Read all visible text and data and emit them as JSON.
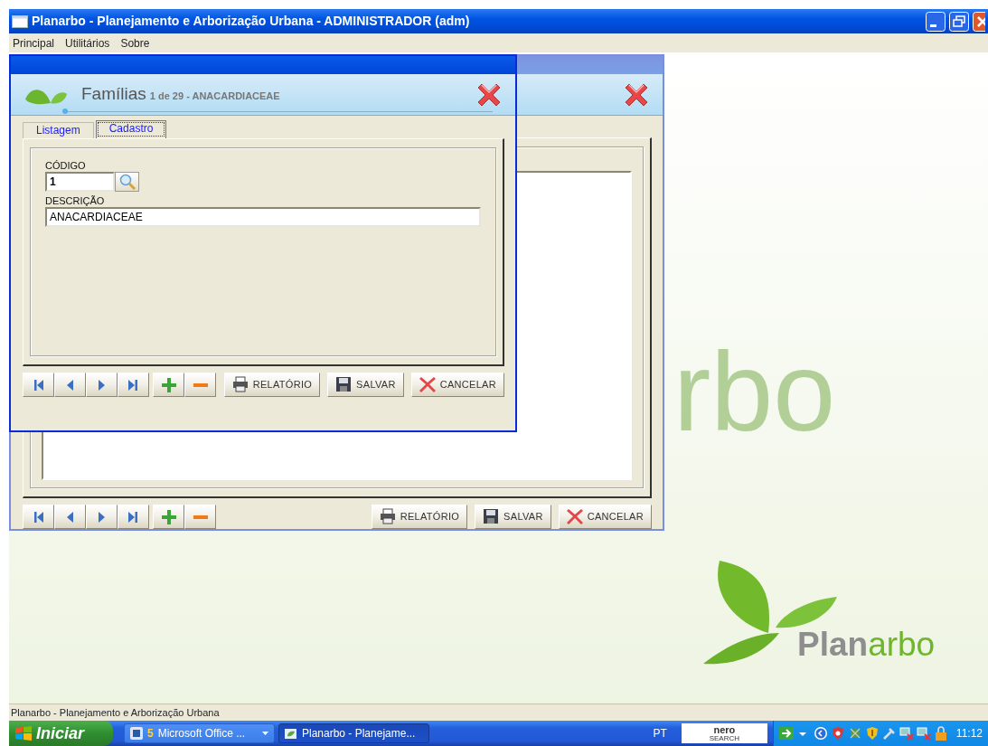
{
  "window": {
    "title": "Planarbo - Planejamento e Arborização Urbana - ADMINISTRADOR (adm)"
  },
  "menu": [
    "Principal",
    "Utilitários",
    "Sobre"
  ],
  "list_form": {
    "nav": [
      {
        "kind": "first"
      },
      {
        "kind": "prev"
      },
      {
        "kind": "next"
      },
      {
        "kind": "last"
      }
    ],
    "edit": [
      {
        "kind": "add"
      },
      {
        "kind": "remove"
      }
    ],
    "buttons": [
      {
        "kind": "report",
        "label": "RELATÓRIO"
      },
      {
        "kind": "save",
        "label": "SALVAR"
      },
      {
        "kind": "cancel",
        "label": "CANCELAR"
      }
    ]
  },
  "form": {
    "title": "Famílias",
    "subtitle": "1 de 29 - ANACARDIACEAE",
    "tabs": [
      {
        "label": "Listagem",
        "selected": false
      },
      {
        "label": "Cadastro",
        "selected": true
      }
    ],
    "fields": [
      {
        "kind": "lookup",
        "label": "CÓDIGO",
        "value": "1"
      },
      {
        "kind": "text",
        "label": "DESCRIÇÃO",
        "value": "ANACARDIACEAE"
      }
    ],
    "nav": [
      {
        "kind": "first"
      },
      {
        "kind": "prev"
      },
      {
        "kind": "next"
      },
      {
        "kind": "last"
      }
    ],
    "edit": [
      {
        "kind": "add"
      },
      {
        "kind": "remove"
      }
    ],
    "buttons": [
      {
        "kind": "report",
        "label": "RELATÓRIO"
      },
      {
        "kind": "save",
        "label": "SALVAR"
      },
      {
        "kind": "cancel",
        "label": "CANCELAR"
      }
    ]
  },
  "background_text": "rbo",
  "logo": {
    "text": "**Plan**arbo"
  },
  "status_bar": "Planarbo - Planejamento e Arborização Urbana",
  "taskbar": {
    "start": "Iniciar",
    "tasks": [
      {
        "kind": "group",
        "count": "5",
        "label": "Microsoft Office ...",
        "selected": false
      },
      {
        "kind": "window",
        "label": "Planarbo - Planejame...",
        "selected": true
      }
    ],
    "language": "PT",
    "search": {
      "brand": "nero",
      "sub": "SEARCH"
    },
    "clock": "11:12"
  }
}
